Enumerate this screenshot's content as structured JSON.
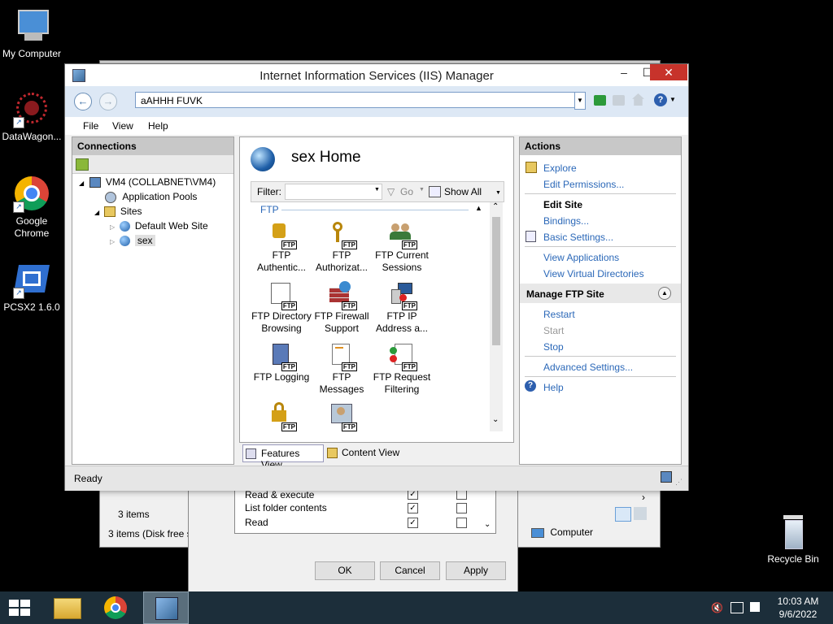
{
  "desktop": {
    "icons": [
      {
        "label": "My Computer",
        "icon": "computer-icon"
      },
      {
        "label": "DataWagon...",
        "icon": "datawagon-icon"
      },
      {
        "label": "Google Chrome",
        "icon": "chrome-icon"
      },
      {
        "label": "PCSX2 1.6.0",
        "icon": "pcsx2-icon"
      },
      {
        "label": "Recycle Bin",
        "icon": "recycle-bin-icon"
      }
    ]
  },
  "background_windows": {
    "explorer": {
      "items_count": "3 items",
      "status": "3 items (Disk free s",
      "location": "Computer"
    },
    "permissions": {
      "rows": [
        {
          "name": "Read & execute"
        },
        {
          "name": "List folder contents"
        },
        {
          "name": "Read"
        }
      ],
      "ok": "OK",
      "cancel": "Cancel",
      "apply": "Apply"
    }
  },
  "window": {
    "title": "Internet Information Services (IIS) Manager",
    "address": "aAHHH FUVK",
    "menu": [
      "File",
      "View",
      "Help"
    ],
    "status": "Ready",
    "connections": {
      "title": "Connections",
      "tree": {
        "server": "VM4 (COLLABNET\\VM4)",
        "app_pools": "Application Pools",
        "sites": "Sites",
        "default_site": "Default Web Site",
        "selected_site": "sex"
      }
    },
    "features": {
      "title": "sex Home",
      "filter_label": "Filter:",
      "go_label": "Go",
      "show_all": "Show All",
      "group": "FTP",
      "items": [
        {
          "line1": "FTP",
          "line2": "Authentic..."
        },
        {
          "line1": "FTP",
          "line2": "Authorizat..."
        },
        {
          "line1": "FTP Current",
          "line2": "Sessions"
        },
        {
          "line1": "FTP Directory",
          "line2": "Browsing"
        },
        {
          "line1": "FTP Firewall",
          "line2": "Support"
        },
        {
          "line1": "FTP IP",
          "line2": "Address a..."
        },
        {
          "line1": "FTP Logging",
          "line2": ""
        },
        {
          "line1": "FTP",
          "line2": "Messages"
        },
        {
          "line1": "FTP Request",
          "line2": "Filtering"
        }
      ],
      "features_view": "Features View",
      "content_view": "Content View"
    },
    "actions": {
      "title": "Actions",
      "explore": "Explore",
      "edit_permissions": "Edit Permissions...",
      "edit_site": "Edit Site",
      "bindings": "Bindings...",
      "basic_settings": "Basic Settings...",
      "view_applications": "View Applications",
      "view_virtual_directories": "View Virtual Directories",
      "manage_ftp_site": "Manage FTP Site",
      "restart": "Restart",
      "start": "Start",
      "stop": "Stop",
      "advanced_settings": "Advanced Settings...",
      "help": "Help"
    }
  },
  "taskbar": {
    "time": "10:03 AM",
    "date": "9/6/2022"
  },
  "colors": {
    "link": "#2b68b8",
    "close": "#c7332b",
    "taskbar": "#1c2e3a"
  }
}
